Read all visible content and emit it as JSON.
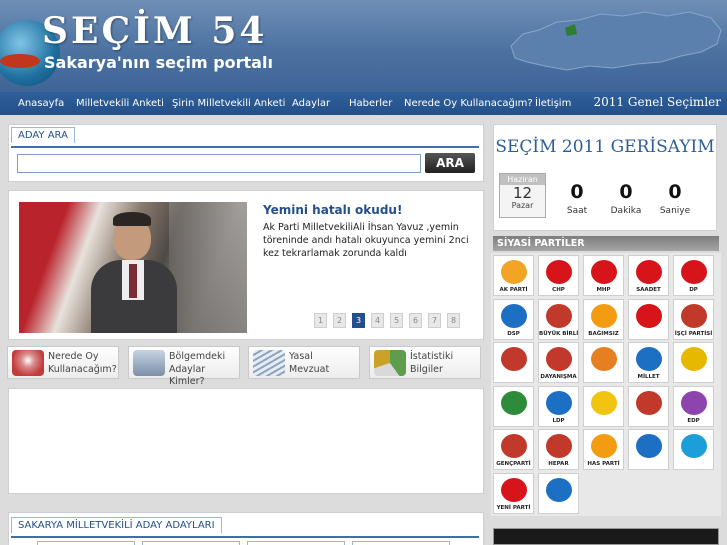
{
  "header": {
    "title": "SEÇİM 54",
    "subtitle": "Sakarya'nın seçim portalı"
  },
  "nav": {
    "items": [
      {
        "label": "Anasayfa"
      },
      {
        "label": "Milletvekili Anketi"
      },
      {
        "label": "Şirin Milletvekili Anketi"
      },
      {
        "label": "Adaylar"
      },
      {
        "label": "Haberler"
      },
      {
        "label": "Nerede Oy Kullanacağım?"
      },
      {
        "label": "İletişim"
      }
    ],
    "election_label": "2011 Genel Seçimler"
  },
  "search": {
    "tab_label": "ADAY ARA",
    "button_label": "ARA",
    "input_value": ""
  },
  "news": {
    "title": "Yemini hatalı okudu!",
    "text": "Ak Parti MilletvekiliAli İhsan Yavuz ,yemin töreninde andı hatalı okuyunca yemini 2nci kez tekrarlamak zorunda kaldı",
    "pages": [
      "1",
      "2",
      "3",
      "4",
      "5",
      "6",
      "7",
      "8"
    ],
    "active_page": "3"
  },
  "quick_links": [
    {
      "line1": "Nerede Oy",
      "line2": "Kullanacağım?",
      "color": "#c23b3b"
    },
    {
      "line1": "Bölgemdeki",
      "line2": "Adaylar Kimler?",
      "color": "#7a8fa8"
    },
    {
      "line1": "Yasal",
      "line2": "Mevzuat",
      "color": "#8fa3bf"
    },
    {
      "line1": "İstatistiki",
      "line2": "Bilgiler",
      "color": "#5d9d4c"
    }
  ],
  "candidates": {
    "tab_label": "SAKARYA MİLLETVEKİLİ ADAY ADAYLARI"
  },
  "countdown": {
    "title": "SEÇİM 2011 GERİSAYIM",
    "calendar_month": "Haziran",
    "calendar_day": "12",
    "calendar_weekday": "Pazar",
    "units": [
      {
        "value": "0",
        "label": "Saat"
      },
      {
        "value": "0",
        "label": "Dakika"
      },
      {
        "value": "0",
        "label": "Saniye"
      }
    ]
  },
  "parties": {
    "heading": "SİYASİ PARTİLER",
    "items": [
      {
        "label": "AK PARTİ",
        "color": "#f2a424"
      },
      {
        "label": "CHP",
        "color": "#d7141a"
      },
      {
        "label": "MHP",
        "color": "#d7141a"
      },
      {
        "label": "SAADET",
        "color": "#d7141a"
      },
      {
        "label": "DP",
        "color": "#d7141a"
      },
      {
        "label": "DSP",
        "color": "#1c6fc2"
      },
      {
        "label": "BÜYÜK BİRLİK",
        "color": "#c0392b"
      },
      {
        "label": "BAĞIMSIZ",
        "color": "#f39c12"
      },
      {
        "label": "",
        "color": "#d7141a"
      },
      {
        "label": "İŞÇİ PARTİSİ",
        "color": "#c0392b"
      },
      {
        "label": "",
        "color": "#c0392b"
      },
      {
        "label": "DAYANIŞMA",
        "color": "#c0392b"
      },
      {
        "label": "",
        "color": "#e67e22"
      },
      {
        "label": "MİLLET",
        "color": "#1c6fc2"
      },
      {
        "label": "",
        "color": "#e6b800"
      },
      {
        "label": "",
        "color": "#2e8b3a"
      },
      {
        "label": "LDP",
        "color": "#1c6fc2"
      },
      {
        "label": "",
        "color": "#f1c40f"
      },
      {
        "label": "",
        "color": "#c0392b"
      },
      {
        "label": "EDP",
        "color": "#8e44ad"
      },
      {
        "label": "GENÇPARTİ",
        "color": "#c0392b"
      },
      {
        "label": "HEPAR",
        "color": "#c0392b"
      },
      {
        "label": "HAS PARTİ",
        "color": "#f39c12"
      },
      {
        "label": "",
        "color": "#1c6fc2"
      },
      {
        "label": "",
        "color": "#1c9fd8"
      },
      {
        "label": "YENİ PARTİ",
        "color": "#d7141a"
      },
      {
        "label": "",
        "color": "#1c6fc2"
      }
    ]
  }
}
